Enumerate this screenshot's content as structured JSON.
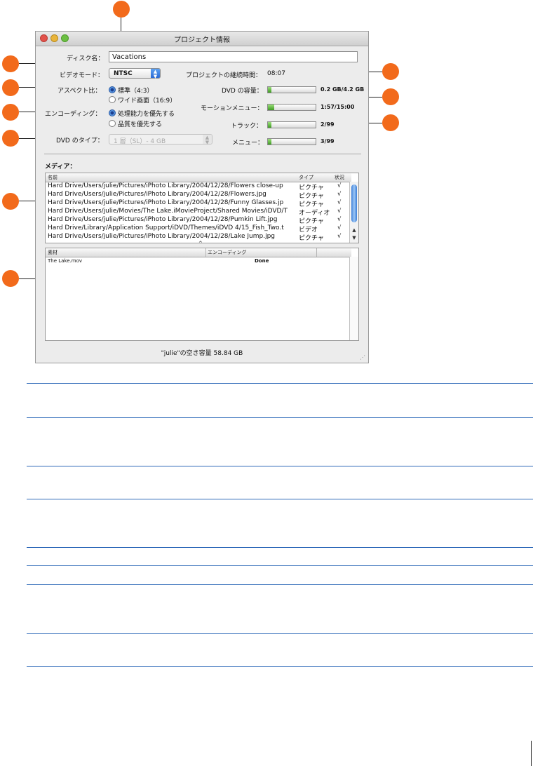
{
  "window": {
    "title": "プロジェクト情報"
  },
  "disc": {
    "name_label": "ディスク名：",
    "name_value": "Vacations"
  },
  "video_mode": {
    "label": "ビデオモード：",
    "value": "NTSC"
  },
  "aspect": {
    "label": "アスペクト比：",
    "options": [
      "標準（4:3）",
      "ワイド画面（16:9）"
    ],
    "selected": "標準（4:3）"
  },
  "encoding": {
    "label": "エンコーディング：",
    "options": [
      "処理能力を優先する",
      "品質を優先する"
    ],
    "selected": "処理能力を優先する"
  },
  "dvd_type": {
    "label": "DVD のタイプ：",
    "value": "1 層（SL）- 4 GB"
  },
  "project_duration": {
    "label": "プロジェクトの継続時間：",
    "value": "08:07"
  },
  "gauges": [
    {
      "label": "DVD の容量：",
      "value": "0.2 GB/4.2 GB",
      "fraction": 0.05
    },
    {
      "label": "モーションメニュー：",
      "value": "1:57/15:00",
      "fraction": 0.13
    },
    {
      "label": "トラック：",
      "value": "2/99",
      "fraction": 0.02
    },
    {
      "label": "メニュー：",
      "value": "3/99",
      "fraction": 0.03
    }
  ],
  "media": {
    "label": "メディア：",
    "columns": [
      "名前",
      "タイプ",
      "状況"
    ],
    "rows": [
      {
        "name": "Hard Drive/Users/julie/Pictures/iPhoto Library/2004/12/28/Flowers close-up",
        "type": "ピクチャ",
        "status": "√"
      },
      {
        "name": "Hard Drive/Users/julie/Pictures/iPhoto Library/2004/12/28/Flowers.jpg",
        "type": "ピクチャ",
        "status": "√"
      },
      {
        "name": "Hard Drive/Users/julie/Pictures/iPhoto Library/2004/12/28/Funny Glasses.jp",
        "type": "ピクチャ",
        "status": "√"
      },
      {
        "name": "Hard Drive/Users/julie/Movies/The Lake.iMovieProject/Shared Movies/iDVD/T",
        "type": "オーディオ",
        "status": "√"
      },
      {
        "name": "Hard Drive/Users/julie/Pictures/iPhoto Library/2004/12/28/Pumkin Lift.jpg",
        "type": "ピクチャ",
        "status": "√"
      },
      {
        "name": "Hard Drive/Library/Application Support/iDVD/Themes/iDVD 4/15_Fish_Two.t",
        "type": "ビデオ",
        "status": "√"
      },
      {
        "name": "Hard Drive/Users/julie/Pictures/iPhoto Library/2004/12/28/Lake Jump.jpg",
        "type": "ピクチャ",
        "status": "√"
      }
    ]
  },
  "assets": {
    "columns": [
      "素材",
      "エンコーディング"
    ],
    "rows": [
      {
        "name": "The Lake.mov",
        "status": "Done"
      }
    ]
  },
  "footer": {
    "free_space": "\"julie\"の空き容量 58.84 GB"
  },
  "colors": {
    "callout": "#f26a1b",
    "rule": "#2e69b8"
  }
}
